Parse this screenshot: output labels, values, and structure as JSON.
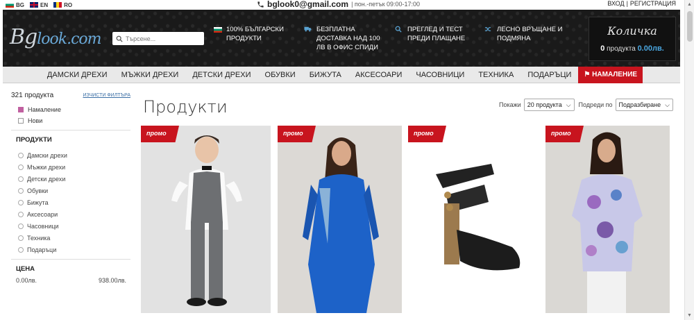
{
  "topbar": {
    "langs": [
      {
        "code": "BG"
      },
      {
        "code": "EN"
      },
      {
        "code": "RO"
      }
    ],
    "email": "bglook0@gmail.com",
    "hours": "| пон.-петък 09:00-17:00",
    "login": "ВХОД",
    "sep": "|",
    "register": "РЕГИСТРАЦИЯ"
  },
  "header": {
    "logo_main": "Bg",
    "logo_rest": "look.com",
    "search_placeholder": "Търсене...",
    "features": [
      {
        "icon": "flag-icon",
        "line1": "100% БЪЛГАРСКИ",
        "line2": "ПРОДУКТИ",
        "line3": ""
      },
      {
        "icon": "truck-icon",
        "line1": "БЕЗПЛАТНА",
        "line2": "ДОСТАВКА НАД 100",
        "line3": "ЛВ В ОФИС СПИДИ"
      },
      {
        "icon": "search-icon",
        "line1": "ПРЕГЛЕД И ТЕСТ",
        "line2": "ПРЕДИ ПЛАЩАНЕ",
        "line3": ""
      },
      {
        "icon": "shuffle-icon",
        "line1": "ЛЕСНО ВРЪЩАНЕ И",
        "line2": "ПОДМЯНА",
        "line3": ""
      }
    ],
    "cart": {
      "title": "Количка",
      "count": "0",
      "count_label": "продукта",
      "total": "0.00лв."
    }
  },
  "nav": {
    "items": [
      "ДАМСКИ ДРЕХИ",
      "МЪЖКИ ДРЕХИ",
      "ДЕТСКИ ДРЕХИ",
      "ОБУВКИ",
      "БИЖУТА",
      "АКСЕСОАРИ",
      "ЧАСОВНИЦИ",
      "ТЕХНИКА",
      "ПОДАРЪЦИ"
    ],
    "sale": "НАМАЛЕНИЕ"
  },
  "sidebar": {
    "count": "321 продукта",
    "clear": "ИЗЧИСТИ ФИЛТЪРА",
    "filters": [
      {
        "label": "Намаление",
        "checked": true
      },
      {
        "label": "Нови",
        "checked": false
      }
    ],
    "products_title": "ПРОДУКТИ",
    "categories": [
      "Дамски дрехи",
      "Мъжки дрехи",
      "Детски дрехи",
      "Обувки",
      "Бижута",
      "Аксесоари",
      "Часовници",
      "Техника",
      "Подаръци"
    ],
    "price_title": "ЦЕНА",
    "price_min": "0.00лв.",
    "price_max": "938.00лв."
  },
  "main": {
    "title": "Продукти",
    "show_label": "Покажи",
    "show_value": "20 продукта",
    "sort_label": "Подреди по",
    "sort_value": "Подразбиране",
    "promo_label": "промо"
  },
  "colors": {
    "accent": "#c8141e",
    "header_bg": "#1a1a1a",
    "link_blue": "#3a6ea5"
  }
}
